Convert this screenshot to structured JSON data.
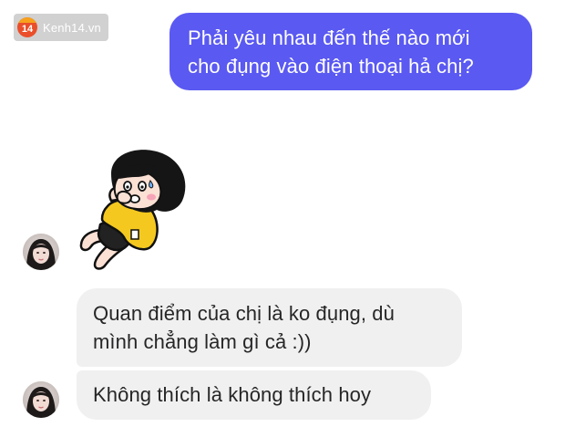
{
  "watermark": {
    "logo_number": "14",
    "site": "Kenh14.vn"
  },
  "messages": [
    {
      "sender": "self",
      "lines": [
        "Phải yêu nhau đến thế nào mới",
        "cho đụng vào điện thoại hả chị?"
      ]
    },
    {
      "sender": "other",
      "lines": [
        "Quan điểm của chị là ko đụng, dù",
        "mình chẳng làm gì cả :))"
      ]
    },
    {
      "sender": "other",
      "lines": [
        "Không thích là không thích hoy"
      ]
    }
  ],
  "icons": {
    "sticker": "crying-cartoon-girl-sticker",
    "avatar": "user-avatar"
  },
  "colors": {
    "outgoing_bubble": "#5a59f2",
    "incoming_bubble": "#f0f0f1",
    "outgoing_text": "#ffffff",
    "incoming_text": "#262626"
  }
}
